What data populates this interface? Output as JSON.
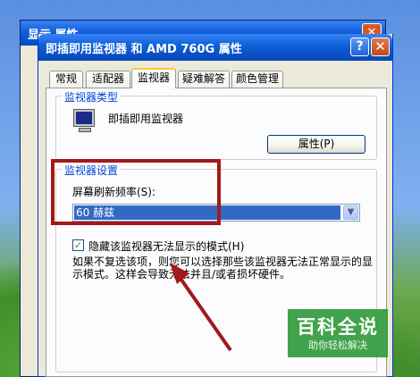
{
  "background_window": {
    "title": "显示 属性",
    "close_symbol": "✕"
  },
  "dialog": {
    "title": "即插即用监视器 和 AMD 760G 属性",
    "help_symbol": "?",
    "close_symbol": "✕"
  },
  "tabs": [
    {
      "label": "常规",
      "active": false
    },
    {
      "label": "适配器",
      "active": false
    },
    {
      "label": "监视器",
      "active": true
    },
    {
      "label": "疑难解答",
      "active": false
    },
    {
      "label": "颜色管理",
      "active": false
    }
  ],
  "monitor_type": {
    "group_title": "监视器类型",
    "name": "即插即用监视器",
    "properties_button": "属性(P)"
  },
  "monitor_settings": {
    "group_title": "监视器设置",
    "refresh_label": "屏幕刷新频率(S):",
    "refresh_value": "60 赫兹",
    "hide_modes_checked": true,
    "hide_modes_label": "隐藏该监视器无法显示的模式(H)",
    "description": "如果不复选该项，则您可以选择那些该监视器无法正常显示的显示模式。这样会导致无法并且/或者损坏硬件。"
  },
  "watermark": {
    "main": "百科全说",
    "sub": "助你轻松解决"
  },
  "colors": {
    "annotation": "#a3181c",
    "title_blue": "#0a52c7",
    "selection": "#316ac5"
  }
}
